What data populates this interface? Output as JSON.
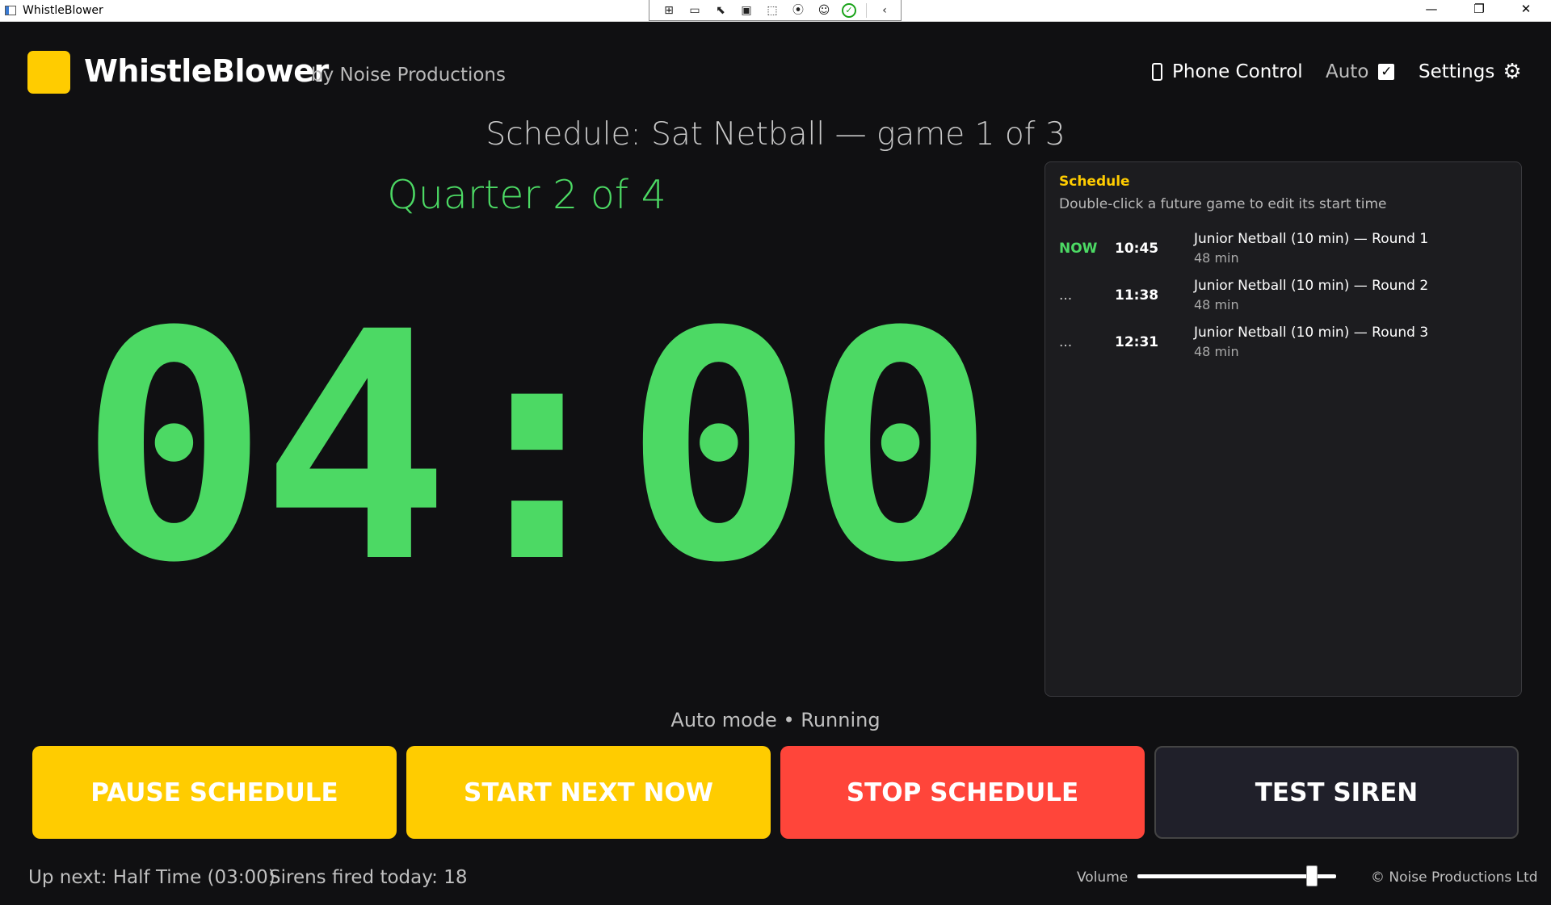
{
  "window": {
    "title": "WhistleBlower",
    "controls": [
      "—",
      "❐",
      "✕"
    ]
  },
  "devbar": {
    "icons": [
      "live-visual-tree-icon",
      "record-icon",
      "select-element-icon",
      "display-layout-adorners-icon",
      "track-focused-element-icon",
      "binding-failures-icon",
      "accessibility-icon",
      "checkmark-icon",
      "collapse-icon"
    ]
  },
  "header": {
    "app_name": "WhistleBlower",
    "byline": "by Noise Productions",
    "phone_control": "Phone Control",
    "auto_label": "Auto",
    "auto_checked": "✓",
    "settings_label": "Settings",
    "settings_icon": "⚙"
  },
  "main": {
    "schedule_title": "Schedule: Sat Netball — game 1 of 3",
    "period": "Quarter 2 of 4",
    "clock": "04:00",
    "status": "Auto mode • Running"
  },
  "schedule_panel": {
    "title": "Schedule",
    "hint": "Double-click a future game to edit its start time",
    "rows": [
      {
        "state": "NOW",
        "time": "10:45",
        "game": "Junior Netball (10 min) — Round 1",
        "duration": "48 min"
      },
      {
        "state": "...",
        "time": "11:38",
        "game": "Junior Netball (10 min) — Round 2",
        "duration": "48 min"
      },
      {
        "state": "...",
        "time": "12:31",
        "game": "Junior Netball (10 min) — Round 3",
        "duration": "48 min"
      }
    ]
  },
  "buttons": {
    "pause": "PAUSE SCHEDULE",
    "next": "START NEXT NOW",
    "stop": "STOP SCHEDULE",
    "test": "TEST SIREN"
  },
  "footer": {
    "up_next": "Up next: Half Time (03:00)",
    "sirens": "Sirens fired today: 18",
    "volume_label": "Volume",
    "volume_value": 0.88,
    "copyright": "© Noise Productions Ltd"
  },
  "colors": {
    "accent": "#ffcc00",
    "clock": "#4cd964",
    "stop": "#ff453a",
    "background": "#101012"
  }
}
